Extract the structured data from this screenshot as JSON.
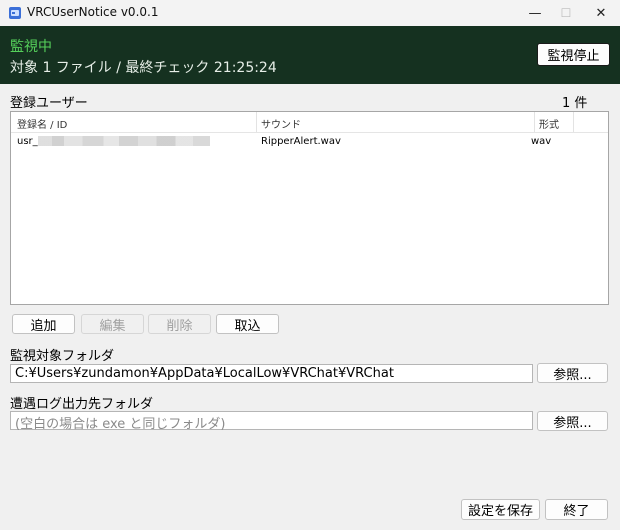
{
  "window": {
    "title": "VRCUserNotice v0.0.1",
    "controls": {
      "minimize": "—",
      "maximize": "☐",
      "close": "✕"
    }
  },
  "banner": {
    "status": "監視中",
    "info": "対象 1 ファイル / 最終チェック 21:25:24",
    "stop_button": "監視停止",
    "colors": {
      "background": "#153120",
      "status": "#55d05a"
    }
  },
  "users": {
    "section_label": "登録ユーザー",
    "count": "1 件",
    "columns": [
      "登録名 / ID",
      "サウンド",
      "形式"
    ],
    "rows": [
      {
        "name": "usr_",
        "sound": "RipperAlert.wav",
        "format": "wav"
      }
    ],
    "buttons": {
      "add": "追加",
      "edit": "編集",
      "delete": "削除",
      "import": "取込"
    }
  },
  "watch_folder": {
    "label": "監視対象フォルダ",
    "value": "C:¥Users¥zundamon¥AppData¥LocalLow¥VRChat¥VRChat",
    "browse": "参照..."
  },
  "log_folder": {
    "label": "遭遇ログ出力先フォルダ",
    "placeholder": "(空白の場合は exe と同じフォルダ)",
    "browse": "参照..."
  },
  "footer": {
    "save": "設定を保存",
    "exit": "終了"
  }
}
